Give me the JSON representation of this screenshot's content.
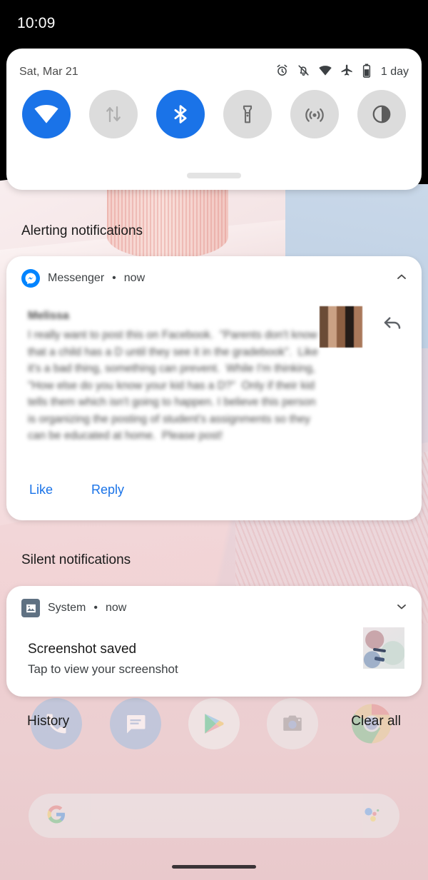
{
  "status_bar": {
    "clock": "10:09"
  },
  "quick_settings": {
    "date": "Sat, Mar 21",
    "battery_label": "1 day",
    "status_icons": [
      {
        "name": "alarm-icon",
        "label": "alarm"
      },
      {
        "name": "notifications-off-icon",
        "label": "notifications off"
      },
      {
        "name": "wifi-icon",
        "label": "wifi"
      },
      {
        "name": "airplane-mode-icon",
        "label": "airplane mode"
      },
      {
        "name": "battery-icon",
        "label": "battery"
      }
    ],
    "tiles": [
      {
        "name": "wifi-tile",
        "label": "Wi-Fi",
        "active": true
      },
      {
        "name": "mobile-data-tile",
        "label": "Mobile data",
        "active": false
      },
      {
        "name": "bluetooth-tile",
        "label": "Bluetooth",
        "active": true
      },
      {
        "name": "flashlight-tile",
        "label": "Flashlight",
        "active": false
      },
      {
        "name": "hotspot-tile",
        "label": "Hotspot",
        "active": false
      },
      {
        "name": "dark-theme-tile",
        "label": "Dark theme",
        "active": false
      }
    ]
  },
  "sections": {
    "alerting_title": "Alerting notifications",
    "silent_title": "Silent notifications"
  },
  "messenger_notification": {
    "app_name": "Messenger",
    "separator": "•",
    "time": "now",
    "sender": "Melissa",
    "message": "I really want to post this on Facebook.  \"Parents don't know that a child has a D until they see it in the gradebook\".  Like it's a bad thing, something can prevent.  While I'm thinking, \"How else do you know your kid has a D?\"  Only if their kid tells them which isn't going to happen. I believe this person is organizing the posting of student's assignments so they can be educated at home.  Please post!",
    "like_label": "Like",
    "reply_label": "Reply",
    "action_color": "#1a73e8"
  },
  "system_notification": {
    "app_name": "System",
    "separator": "•",
    "time": "now",
    "title": "Screenshot saved",
    "text": "Tap to view your screenshot"
  },
  "shade_footer": {
    "history_label": "History",
    "clear_all_label": "Clear all"
  },
  "home_screen": {
    "dock_icons": [
      {
        "name": "phone-icon",
        "label": "Phone"
      },
      {
        "name": "messages-icon",
        "label": "Messages"
      },
      {
        "name": "play-store-icon",
        "label": "Play Store"
      },
      {
        "name": "camera-icon",
        "label": "Camera"
      },
      {
        "name": "chrome-icon",
        "label": "Chrome"
      }
    ],
    "search_bar": {
      "google_logo": "google-g-icon",
      "assistant_icon": "assistant-icon"
    }
  },
  "colors": {
    "accent_blue": "#1a73e8",
    "messenger_blue": "#0084ff",
    "tile_off": "#dcdcdc",
    "card_bg": "#ffffff",
    "status_bar_bg": "#000000"
  }
}
